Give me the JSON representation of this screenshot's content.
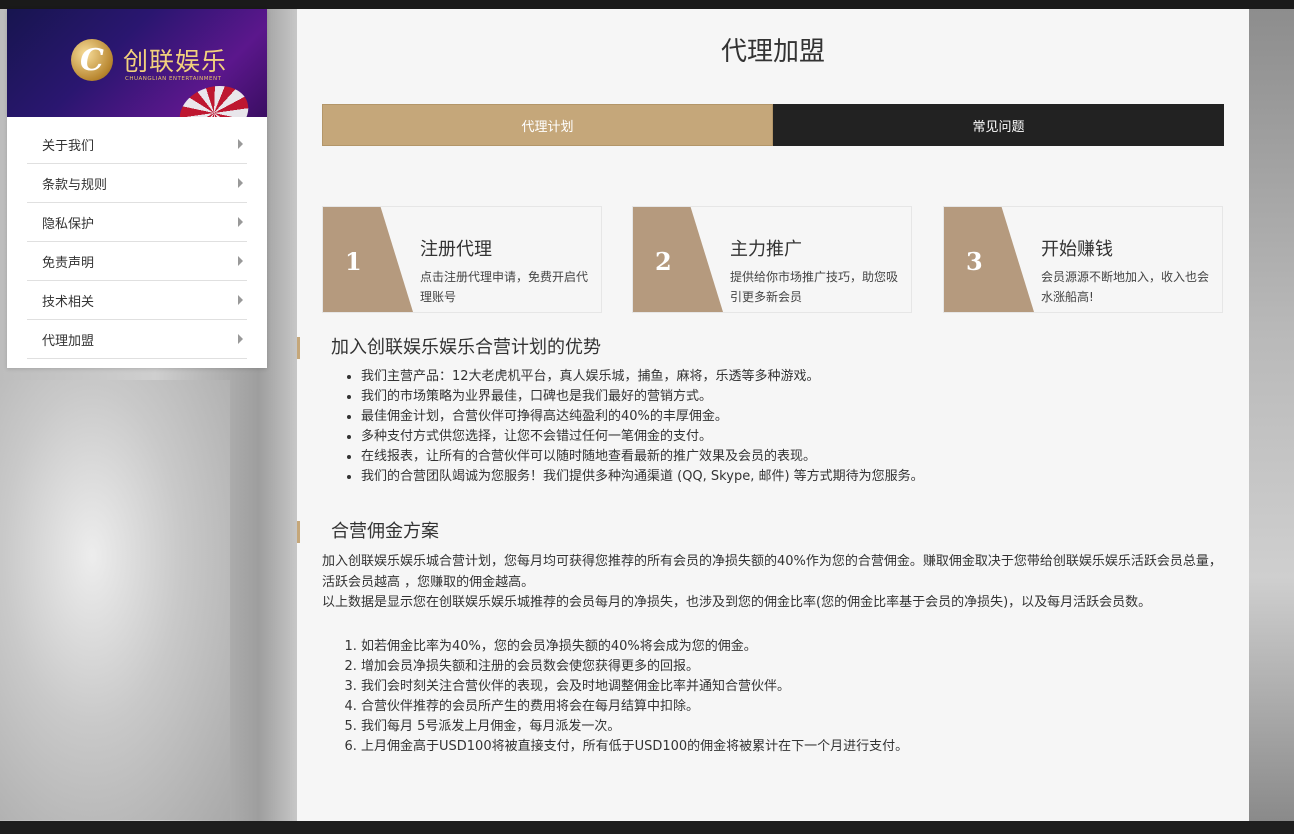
{
  "sidebar": {
    "logo": {
      "name_cn": "创联娱乐",
      "name_en": "CHUANGLIAN ENTERTAINMENT",
      "mark": "C"
    },
    "items": [
      {
        "label": "关于我们"
      },
      {
        "label": "条款与规则"
      },
      {
        "label": "隐私保护"
      },
      {
        "label": "免责声明"
      },
      {
        "label": "技术相关"
      },
      {
        "label": "代理加盟"
      }
    ]
  },
  "main": {
    "title": "代理加盟",
    "tabs": [
      {
        "label": "代理计划",
        "active": true
      },
      {
        "label": "常见问题",
        "active": false
      }
    ],
    "steps": [
      {
        "num": "1",
        "title": "注册代理",
        "desc": "点击注册代理申请，免费开启代理账号"
      },
      {
        "num": "2",
        "title": "主力推广",
        "desc": "提供给你市场推广技巧，助您吸引更多新会员"
      },
      {
        "num": "3",
        "title": "开始赚钱",
        "desc": "会员源源不断地加入，收入也会水涨船高!"
      }
    ],
    "advantages": {
      "heading": "加入创联娱乐娱乐合营计划的优势",
      "items": [
        "我们主营产品：12大老虎机平台，真人娱乐城，捕鱼，麻将，乐透等多种游戏。",
        "我们的市场策略为业界最佳，口碑也是我们最好的营销方式。",
        "最佳佣金计划，合营伙伴可挣得高达纯盈利的40%的丰厚佣金。",
        "多种支付方式供您选择，让您不会错过任何一笔佣金的支付。",
        "在线报表，让所有的合营伙伴可以随时随地查看最新的推广效果及会员的表现。",
        "我们的合营团队竭诚为您服务！我们提供多种沟通渠道 (QQ, Skype, 邮件) 等方式期待为您服务。"
      ]
    },
    "commission": {
      "heading": "合营佣金方案",
      "para1": "加入创联娱乐娱乐城合营计划，您每月均可获得您推荐的所有会员的净损失额的40%作为您的合营佣金。赚取佣金取决于您带给创联娱乐娱乐活跃会员总量，活跃会员越高 ，您赚取的佣金越高。",
      "para2": "以上数据是显示您在创联娱乐娱乐城推荐的会员每月的净损失，也涉及到您的佣金比率(您的佣金比率基于会员的净损失)，以及每月活跃会员数。",
      "items": [
        "如若佣金比率为40%，您的会员净损失额的40%将会成为您的佣金。",
        "增加会员净损失额和注册的会员数会使您获得更多的回报。",
        "我们会时刻关注合营伙伴的表现，会及时地调整佣金比率并通知合营伙伴。",
        "合营伙伴推荐的会员所产生的费用将会在每月结算中扣除。",
        "我们每月 5号派发上月佣金，每月派发一次。",
        "上月佣金高于USD100将被直接支付，所有低于USD100的佣金将被累计在下一个月进行支付。"
      ]
    }
  },
  "colors": {
    "accent": "#c5a77a",
    "step_block": "#b59a7e",
    "dark_tab": "#222222"
  }
}
